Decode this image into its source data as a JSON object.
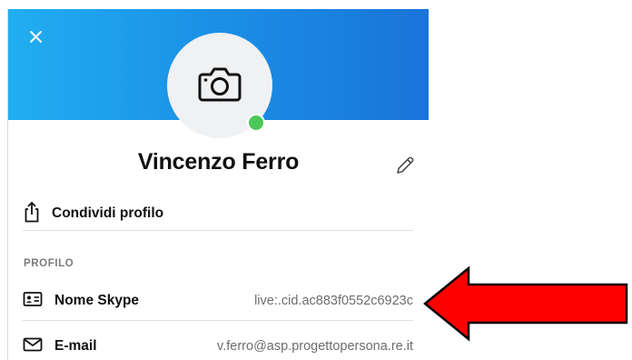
{
  "profile": {
    "name": "Vincenzo Ferro",
    "online_color": "#4cc85a",
    "header_gradient": [
      "#21aef0",
      "#1a74d9"
    ]
  },
  "actions": {
    "share_label": "Condividi profilo"
  },
  "section": {
    "title": "PROFILO",
    "rows": [
      {
        "label": "Nome Skype",
        "value": "live:.cid.ac883f0552c6923c",
        "icon": "contact-card-icon"
      },
      {
        "label": "E-mail",
        "value": "v.ferro@asp.progettopersona.re.it",
        "icon": "mail-icon"
      }
    ]
  },
  "annotation": {
    "color": "#ff0000",
    "icon": "red-arrow-left"
  }
}
